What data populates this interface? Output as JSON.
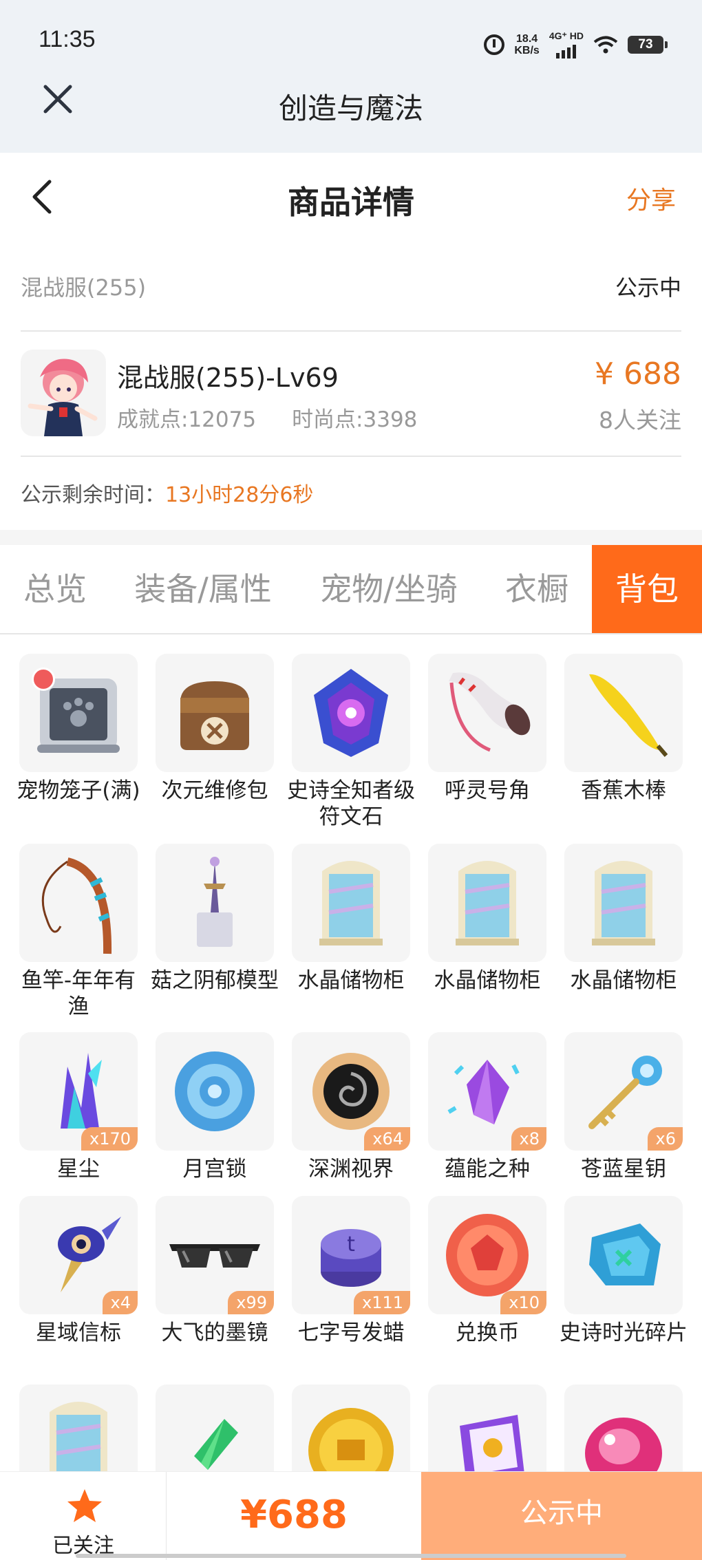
{
  "status_bar": {
    "time": "11:35",
    "net_speed_value": "18.4",
    "net_speed_unit": "KB/s",
    "net_type": "4G⁺ HD",
    "battery": "73"
  },
  "app_bar": {
    "title": "创造与魔法"
  },
  "header": {
    "title": "商品详情",
    "share": "分享"
  },
  "listing": {
    "server": "混战服(255)",
    "status": "公示中",
    "title": "混战服(255)-Lv69",
    "achievement": "成就点:12075",
    "fashion": "时尚点:3398",
    "price": "¥ 688",
    "followers": "8人关注",
    "timer_label": "公示剩余时间：",
    "timer_value": "13小时28分6秒"
  },
  "tabs": [
    {
      "label": "总览",
      "active": false
    },
    {
      "label": "装备/属性",
      "active": false
    },
    {
      "label": "宠物/坐骑",
      "active": false
    },
    {
      "label": "衣橱",
      "active": false
    },
    {
      "label": "背包",
      "active": true
    }
  ],
  "items": [
    {
      "name": "宠物笼子(满)",
      "icon": "pet-cage-icon",
      "count": ""
    },
    {
      "name": "次元维修包",
      "icon": "repair-bag-icon",
      "count": ""
    },
    {
      "name": "史诗全知者级符文石",
      "icon": "rune-stone-icon",
      "count": ""
    },
    {
      "name": "呼灵号角",
      "icon": "horn-icon",
      "count": ""
    },
    {
      "name": "香蕉木棒",
      "icon": "banana-stick-icon",
      "count": ""
    },
    {
      "name": "鱼竿-年年有渔",
      "icon": "fishing-rod-icon",
      "count": ""
    },
    {
      "name": "菇之阴郁模型",
      "icon": "model-icon",
      "count": ""
    },
    {
      "name": "水晶储物柜",
      "icon": "crystal-cabinet-icon",
      "count": ""
    },
    {
      "name": "水晶储物柜",
      "icon": "crystal-cabinet-icon",
      "count": ""
    },
    {
      "name": "水晶储物柜",
      "icon": "crystal-cabinet-icon",
      "count": ""
    },
    {
      "name": "星尘",
      "icon": "stardust-icon",
      "count": "x170"
    },
    {
      "name": "月宫锁",
      "icon": "moon-lock-icon",
      "count": ""
    },
    {
      "name": "深渊视界",
      "icon": "abyss-vision-icon",
      "count": "x64"
    },
    {
      "name": "蕴能之种",
      "icon": "energy-seed-icon",
      "count": "x8"
    },
    {
      "name": "苍蓝星钥",
      "icon": "azure-key-icon",
      "count": "x6"
    },
    {
      "name": "星域信标",
      "icon": "star-beacon-icon",
      "count": "x4"
    },
    {
      "name": "大飞的墨镜",
      "icon": "sunglasses-icon",
      "count": "x99"
    },
    {
      "name": "七字号发蜡",
      "icon": "hair-wax-icon",
      "count": "x111"
    },
    {
      "name": "兑换币",
      "icon": "exchange-coin-icon",
      "count": "x10"
    },
    {
      "name": "史诗时光碎片",
      "icon": "time-fragment-icon",
      "count": ""
    },
    {
      "name": "",
      "icon": "crystal-cabinet-icon",
      "count": ""
    },
    {
      "name": "",
      "icon": "green-crystal-icon",
      "count": ""
    },
    {
      "name": "",
      "icon": "gold-coin-icon",
      "count": ""
    },
    {
      "name": "",
      "icon": "ticket-icon",
      "count": ""
    },
    {
      "name": "",
      "icon": "pink-gem-icon",
      "count": ""
    }
  ],
  "bottom_bar": {
    "follow_label": "已关注",
    "price": "¥688",
    "status_button": "公示中"
  },
  "colors": {
    "accent": "#ff6a1a",
    "price": "#e87722",
    "badge": "#f4a46a",
    "status_button": "#ffad7a"
  }
}
